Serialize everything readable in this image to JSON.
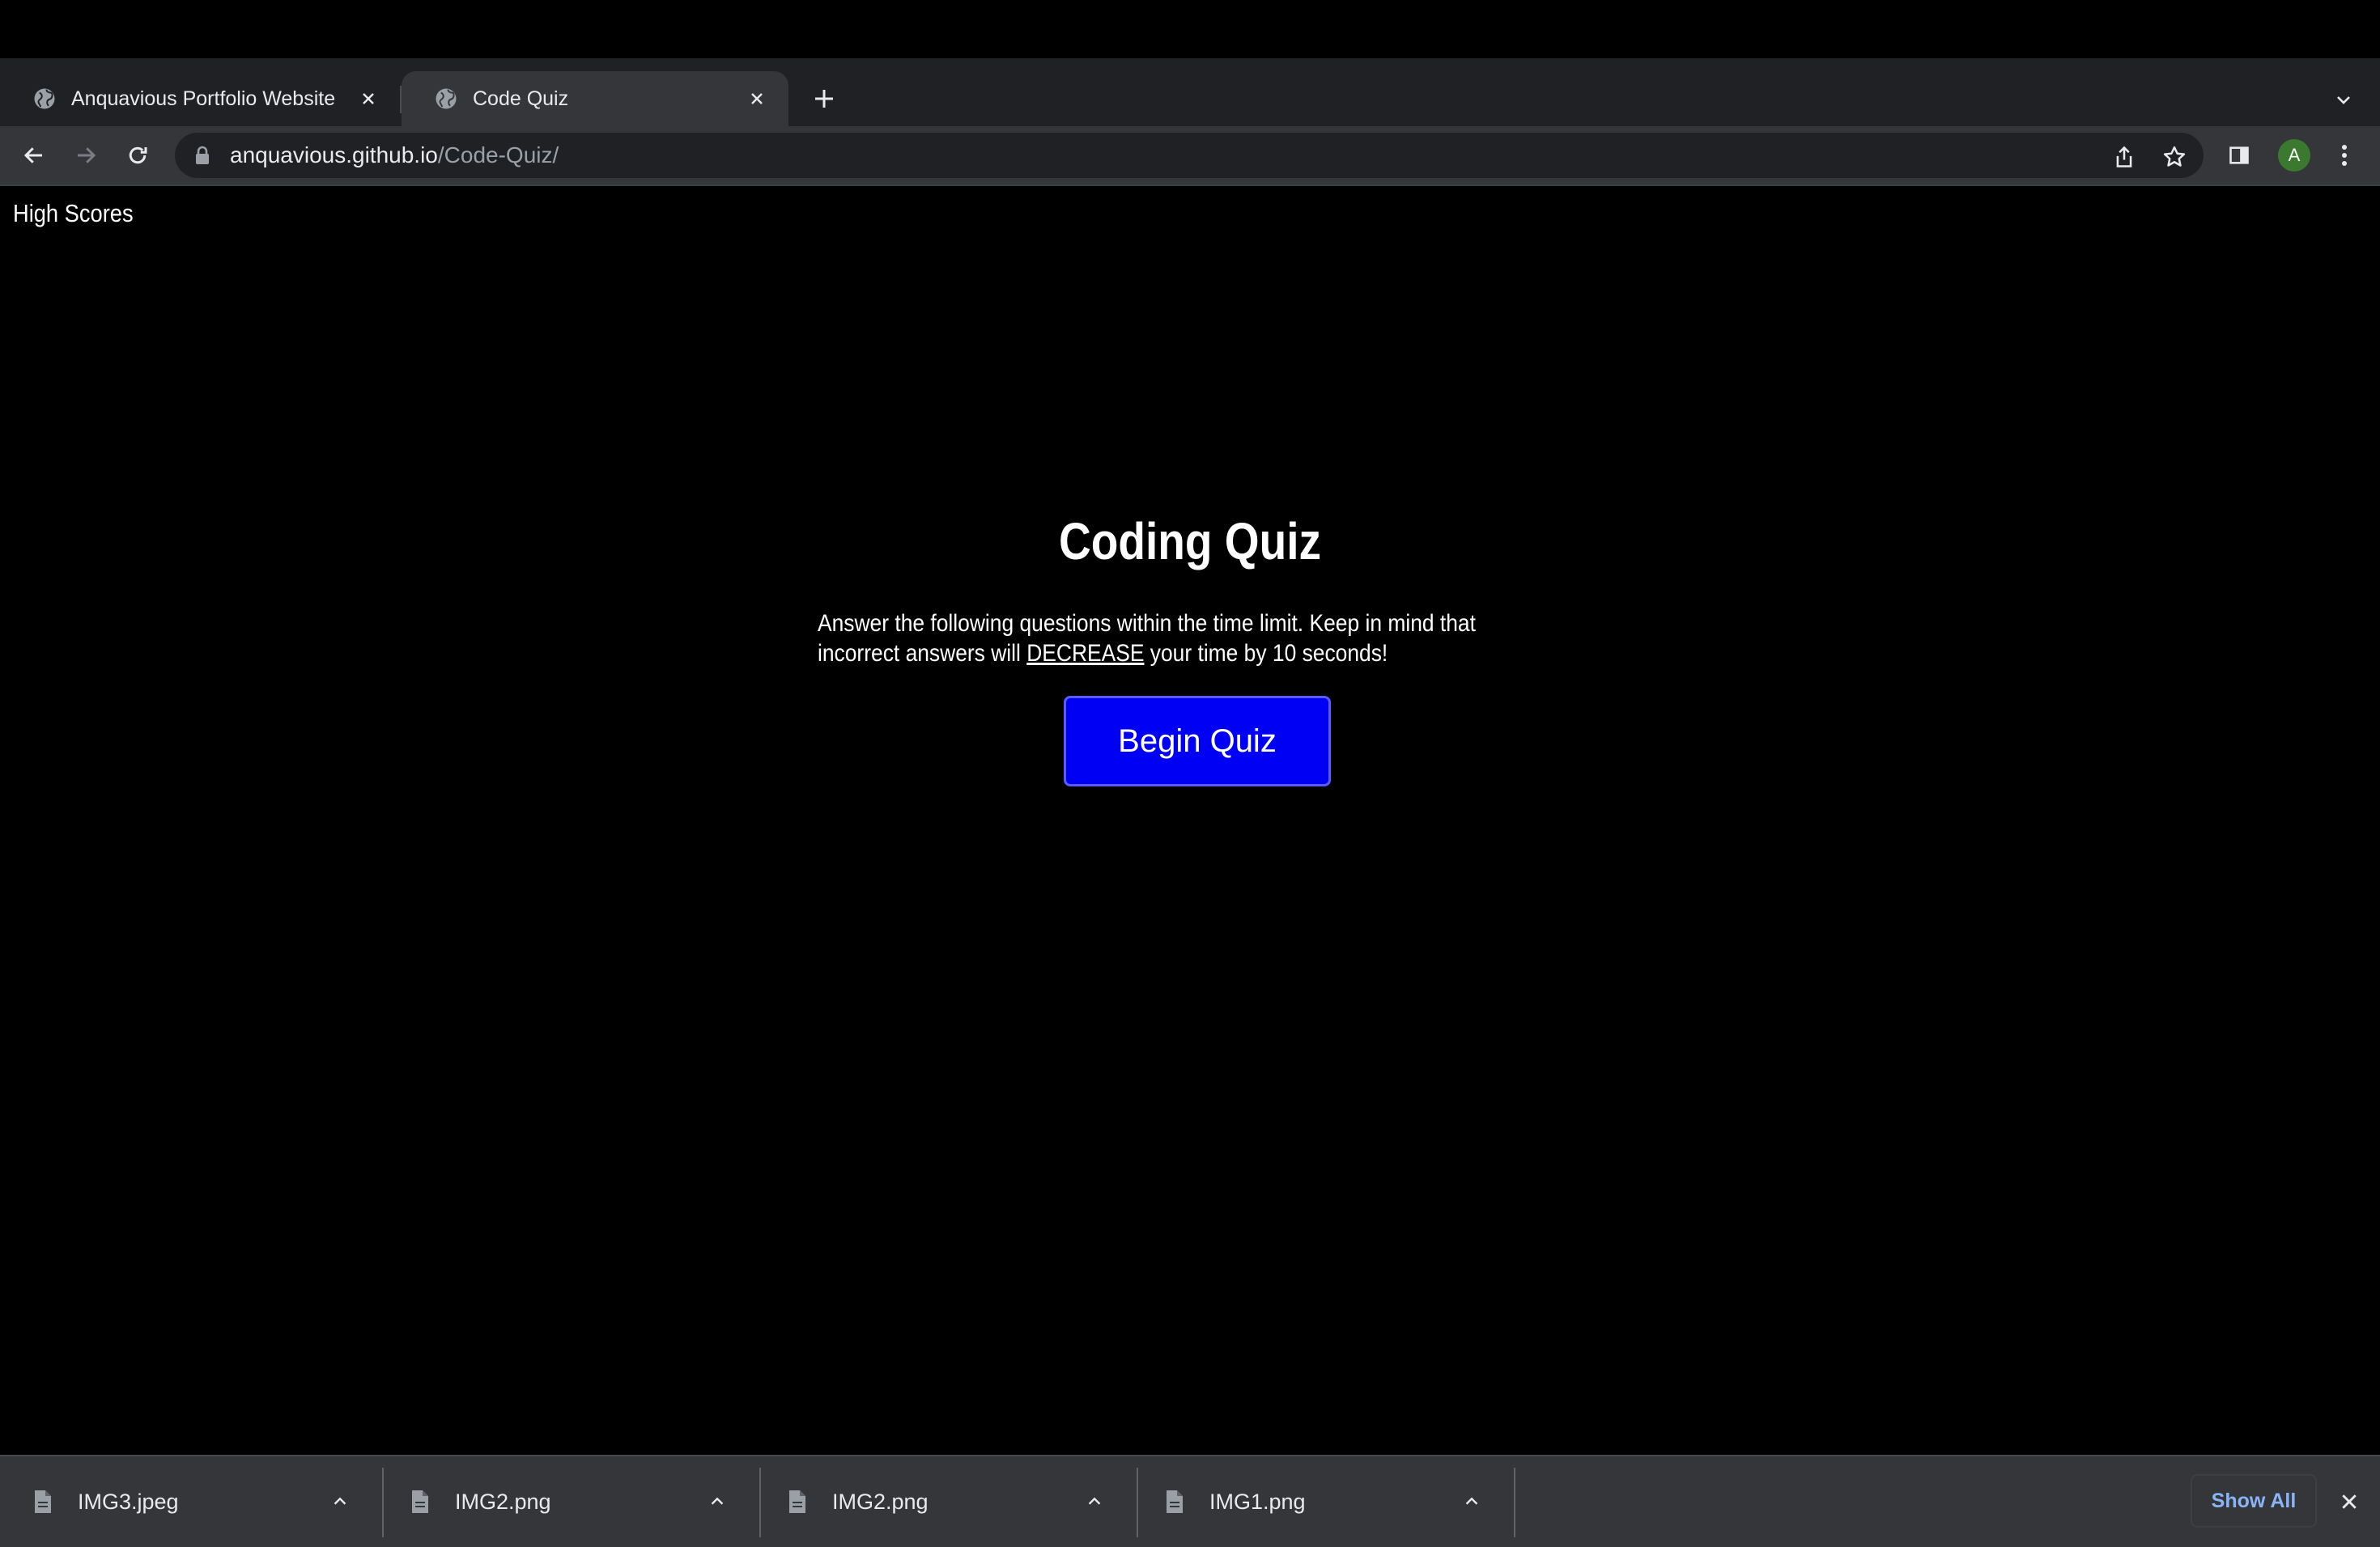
{
  "browser": {
    "tabs": [
      {
        "title": "Anquavious Portfolio Website",
        "icon": "globe-icon",
        "active": false
      },
      {
        "title": "Code Quiz",
        "icon": "globe-icon",
        "active": true
      }
    ],
    "address": {
      "host": "anquavious.github.io",
      "path": "/Code-Quiz/"
    },
    "profile_initial": "A",
    "colors": {
      "tabstrip": "#202124",
      "toolbar": "#35363a",
      "avatar": "#3b7a2e"
    }
  },
  "page": {
    "nav_link": "High Scores",
    "title": "Coding Quiz",
    "description_before": "Answer the following questions within the time limit. Keep in mind that incorrect answers will ",
    "description_emphasis": "DECREASE",
    "description_after": " your time by 10 seconds!",
    "start_button": "Begin Quiz",
    "colors": {
      "background": "#000000",
      "button": "#0000f5"
    }
  },
  "downloads": {
    "items": [
      {
        "name": "IMG3.jpeg"
      },
      {
        "name": "IMG2.png"
      },
      {
        "name": "IMG2.png"
      },
      {
        "name": "IMG1.png"
      }
    ],
    "show_all": "Show All"
  }
}
